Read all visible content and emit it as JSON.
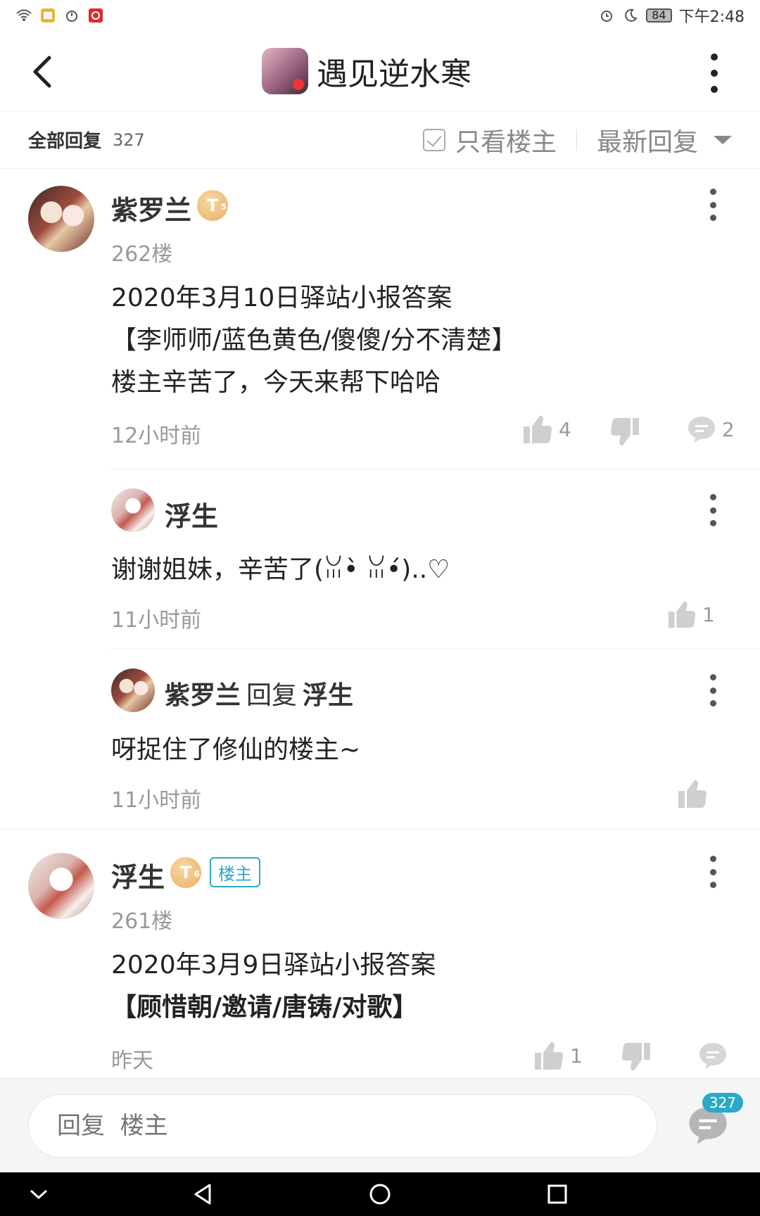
{
  "status_bar": {
    "time": "下午2:48",
    "battery": "84",
    "left_icons": [
      "wifi-icon",
      "app-notification-icon",
      "timer-icon",
      "netease-icon"
    ],
    "right_icons": [
      "alarm-icon",
      "moon-icon",
      "battery-icon"
    ]
  },
  "header": {
    "title": "遇见逆水寒",
    "back_icon": "chevron-left-icon",
    "more_icon": "more-vertical-icon"
  },
  "filter": {
    "all_replies_label": "全部回复",
    "count": "327",
    "only_op_label": "只看楼主",
    "sort_label": "最新回复"
  },
  "posts": [
    {
      "author": "紫罗兰",
      "level_badge": "T",
      "level_num": "5",
      "floor": "262楼",
      "lines": [
        "2020年3月10日驿站小报答案",
        "【李师师/蓝色黄色/傻傻/分不清楚】",
        "楼主辛苦了，今天来帮下哈哈"
      ],
      "time": "12小时前",
      "likes": "4",
      "comments": "2",
      "replies": [
        {
          "author": "浮生",
          "text": "谢谢姐妹，辛苦了(ꈍ•̀ ꈍ•́)..♡",
          "time": "11小时前",
          "likes": "1"
        },
        {
          "author": "紫罗兰",
          "reply_word": "回复",
          "reply_to": "浮生",
          "text": "呀捉住了修仙的楼主~",
          "time": "11小时前"
        }
      ]
    },
    {
      "author": "浮生",
      "level_badge": "T",
      "level_num": "6",
      "op_badge": "楼主",
      "floor": "261楼",
      "lines": [
        "2020年3月9日驿站小报答案",
        "【顾惜朝/邀请/唐铸/对歌】"
      ],
      "time": "昨天",
      "likes": "1"
    }
  ],
  "bottom": {
    "placeholder": "回复  楼主",
    "comment_count": "327"
  },
  "nav": [
    "hide-keyboard-icon",
    "back-triangle-icon",
    "home-circle-icon",
    "recents-square-icon"
  ],
  "colors": {
    "accent": "#2aa9c8",
    "badge_gold": "#e9b064"
  }
}
